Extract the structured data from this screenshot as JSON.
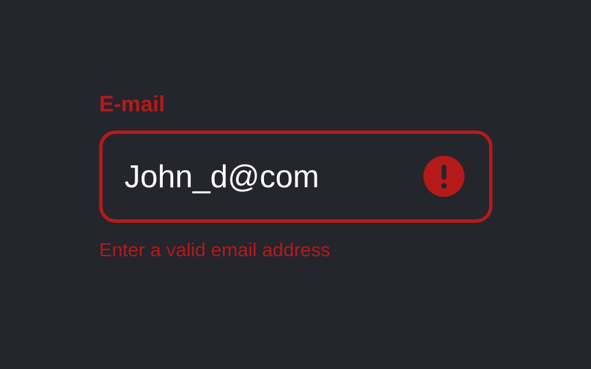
{
  "email_field": {
    "label": "E-mail",
    "value": "John_d@com",
    "error_icon": "exclamation-circle-icon",
    "error_message": "Enter a valid email address"
  },
  "colors": {
    "background": "#24252d",
    "error": "#b51a1a",
    "text": "#ffffff"
  }
}
